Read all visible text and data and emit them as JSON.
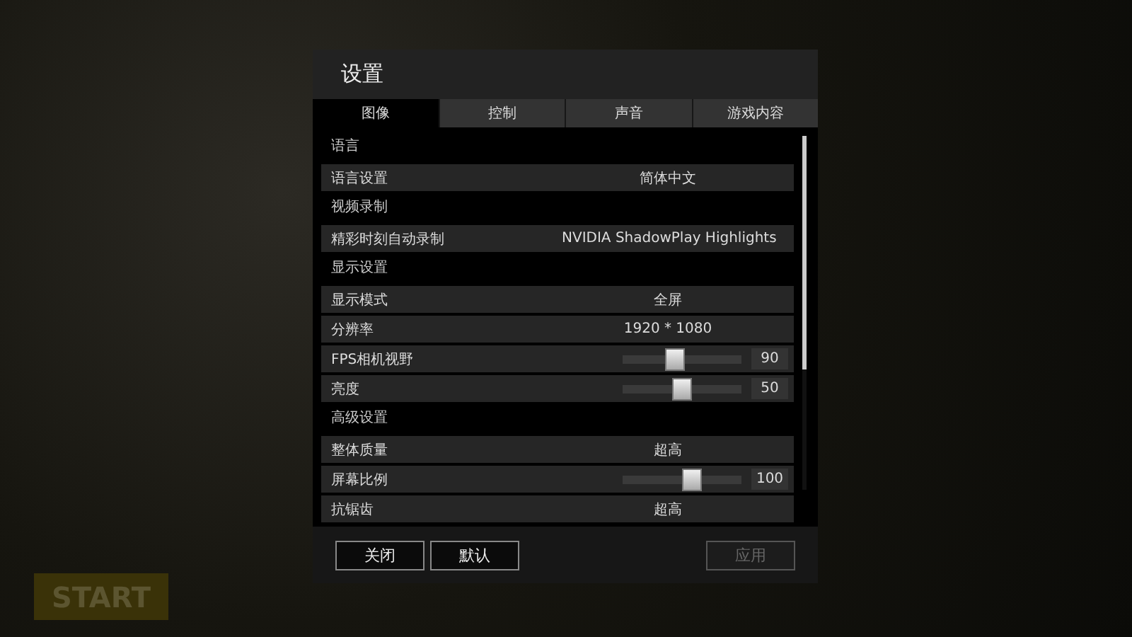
{
  "background": {
    "start_button": "START"
  },
  "dialog": {
    "title": "设置",
    "tabs": [
      {
        "label": "图像",
        "selected": true
      },
      {
        "label": "控制",
        "selected": false
      },
      {
        "label": "声音",
        "selected": false
      },
      {
        "label": "游戏内容",
        "selected": false
      }
    ],
    "sections": [
      {
        "heading": "语言",
        "rows": [
          {
            "kind": "value",
            "label": "语言设置",
            "value": "简体中文"
          }
        ]
      },
      {
        "heading": "视频录制",
        "rows": [
          {
            "kind": "value",
            "label": "精彩时刻自动录制",
            "value": "NVIDIA ShadowPlay Highlights"
          }
        ]
      },
      {
        "heading": "显示设置",
        "rows": [
          {
            "kind": "value",
            "label": "显示模式",
            "value": "全屏"
          },
          {
            "kind": "value",
            "label": "分辨率",
            "value": "1920 * 1080"
          },
          {
            "kind": "slider",
            "label": "FPS相机视野",
            "level": 0.43,
            "value": "90"
          },
          {
            "kind": "slider",
            "label": "亮度",
            "level": 0.5,
            "value": "50"
          }
        ]
      },
      {
        "heading": "高级设置",
        "rows": [
          {
            "kind": "value",
            "label": "整体质量",
            "value": "超高"
          },
          {
            "kind": "slider",
            "label": "屏幕比例",
            "level": 0.6,
            "value": "100"
          },
          {
            "kind": "value",
            "label": "抗锯齿",
            "value": "超高"
          }
        ]
      }
    ],
    "buttons": [
      {
        "label": "关闭",
        "disabled": false
      },
      {
        "label": "默认",
        "disabled": false
      },
      {
        "label": "应用",
        "disabled": true
      }
    ]
  }
}
